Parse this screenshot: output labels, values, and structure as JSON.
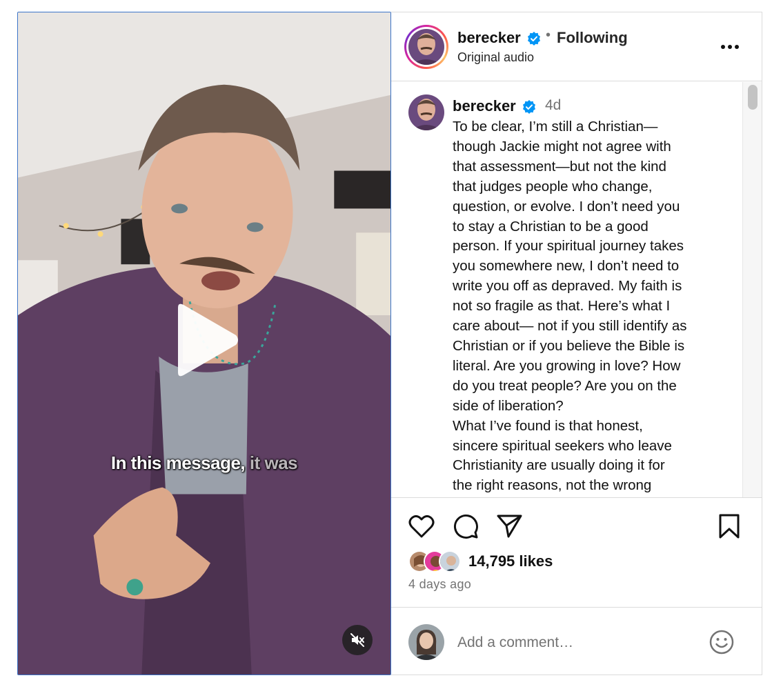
{
  "video": {
    "caption_bright": "In this message,",
    "caption_dim": " it was",
    "play_icon": "play-icon",
    "mute_icon": "muted-speaker-icon"
  },
  "header": {
    "username": "berecker",
    "separator": "•",
    "follow_status": "Following",
    "audio_label": "Original audio",
    "verified_icon": "verified-badge-icon",
    "more_icon": "more-options-icon"
  },
  "caption": {
    "username": "berecker",
    "time": "4d",
    "text": "To be clear, I’m still a Christian—\nthough Jackie might not agree with\nthat assessment—but not the kind\nthat judges people who change,\nquestion, or evolve. I don’t need you\nto stay a Christian to be a good\nperson. If your spiritual journey takes\nyou somewhere new, I don’t need to\nwrite you off as depraved. My faith is\nnot so fragile as that. Here’s what I\ncare about— not if you still identify as\nChristian or if you believe the Bible is\nliteral. Are you growing in love? How\ndo you treat people? Are you on the\nside of liberation?\nWhat I’ve found is that honest,\nsincere spiritual seekers who leave\nChristianity are usually doing it for\nthe right reasons, not the wrong\nreasons. It’s a deeply spiritual choice"
  },
  "actions": {
    "like_icon": "heart-icon",
    "comment_icon": "comment-icon",
    "share_icon": "share-icon",
    "save_icon": "bookmark-icon"
  },
  "engagement": {
    "likes": "14,795 likes",
    "posted": "4 days ago"
  },
  "comment": {
    "placeholder": "Add a comment…",
    "emoji_icon": "emoji-icon"
  },
  "colors": {
    "verified_blue": "#0095f6",
    "border": "#dbdbdb",
    "secondary_text": "#737373"
  }
}
